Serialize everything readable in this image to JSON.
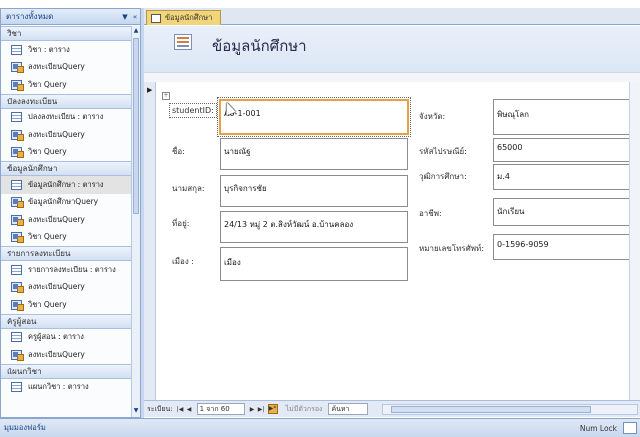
{
  "navigation_pane": {
    "title": "ตารางทั้งหมด",
    "groups": [
      {
        "label": "วิชา",
        "items": [
          {
            "label": "วิชา : ตาราง",
            "type": "table"
          },
          {
            "label": "ลงทะเบียนQuery",
            "type": "query"
          },
          {
            "label": "วิชา Query",
            "type": "query"
          }
        ]
      },
      {
        "label": "ปลงลงทะเบียน",
        "items": [
          {
            "label": "ปลงลงทะเบียน : ตาราง",
            "type": "table"
          },
          {
            "label": "ลงทะเบียนQuery",
            "type": "query"
          },
          {
            "label": "วิชา Query",
            "type": "query"
          }
        ]
      },
      {
        "label": "ข้อมูลนักศึกษา",
        "items": [
          {
            "label": "ข้อมูลนักศึกษา : ตาราง",
            "type": "table",
            "selected": true
          },
          {
            "label": "ข้อมูลนักศึกษาQuery",
            "type": "query"
          },
          {
            "label": "ลงทะเบียนQuery",
            "type": "query"
          },
          {
            "label": "วิชา Query",
            "type": "query"
          }
        ]
      },
      {
        "label": "รายการลงทะเบียน",
        "items": [
          {
            "label": "รายการลงทะเบียน : ตาราง",
            "type": "table"
          },
          {
            "label": "ลงทะเบียนQuery",
            "type": "query"
          },
          {
            "label": "วิชา Query",
            "type": "query"
          }
        ]
      },
      {
        "label": "ครูผู้สอน",
        "items": [
          {
            "label": "ครูผู้สอน : ตาราง",
            "type": "table"
          },
          {
            "label": "ลงทะเบียนQuery",
            "type": "query"
          }
        ]
      },
      {
        "label": "แผนกวิชา",
        "items": [
          {
            "label": "แผนกวิชา : ตาราง",
            "type": "table"
          }
        ]
      }
    ]
  },
  "document_tab": {
    "label": "ข้อมูลนักศึกษา"
  },
  "form": {
    "title": "ข้อมูลนักศึกษา",
    "fields": {
      "student_id": {
        "label": "studentID:",
        "value": "A0-1-001"
      },
      "first_name": {
        "label": "ชื่อ:",
        "value": "นายณัฐ"
      },
      "last_name": {
        "label": "นามสกุล:",
        "value": "บุรกิจการชัย"
      },
      "address": {
        "label": "ที่อยู่:",
        "value": "24/13 หมู่ 2 ต.สิงห์วัฒน์ อ.บ้านคลอง"
      },
      "city": {
        "label": "เมือง :",
        "value": "เมือง"
      },
      "province": {
        "label": "จังหวัด:",
        "value": "พิษณุโลก"
      },
      "postal_code": {
        "label": "รหัสไปรษณีย์:",
        "value": "65000"
      },
      "education": {
        "label": "วุฒิการศึกษา:",
        "value": "ม.4"
      },
      "occupation": {
        "label": "อาชีพ:",
        "value": "นักเรียน"
      },
      "phone": {
        "label": "หมายเลขโทรศัพท์:",
        "value": "0-1596-9059"
      }
    }
  },
  "record_navigator": {
    "caption": "ระเบียน:",
    "position": "1 จาก 60",
    "filter_label": "ไม่มีตัวกรอง",
    "search_label": "ค้นหา"
  },
  "status_bar": {
    "left_text": "มุมมองฟอร์ม",
    "num_lock": "Num Lock"
  },
  "colors": {
    "accent": "#15428b",
    "tab_active": "#f2d57a",
    "focus_border": "#e3a24a"
  }
}
